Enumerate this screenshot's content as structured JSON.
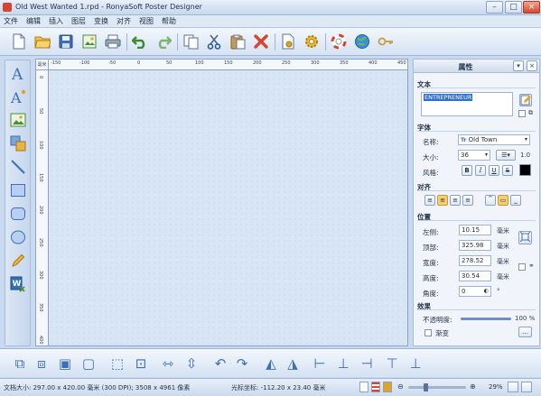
{
  "window": {
    "title": "Old West Wanted 1.rpd - RonyaSoft Poster Designer"
  },
  "menu": {
    "items": [
      "文件",
      "编辑",
      "插入",
      "图层",
      "变换",
      "对齐",
      "视图",
      "帮助"
    ]
  },
  "toolbar": {
    "buttons": [
      "new-icon",
      "open-icon",
      "save-icon",
      "export-icon",
      "print-icon",
      "undo-icon",
      "redo-icon",
      "copy-icon",
      "cut-icon",
      "paste-icon",
      "delete-icon",
      "page-settings-icon",
      "preferences-icon",
      "help-icon",
      "web-icon",
      "register-icon"
    ]
  },
  "left_tools": [
    "text-tool-icon",
    "curved-text-tool-icon",
    "image-tool-icon",
    "clipart-tool-icon",
    "line-tool-icon",
    "rectangle-tool-icon",
    "rounded-rectangle-tool-icon",
    "ellipse-tool-icon",
    "pencil-tool-icon",
    "word-art-tool-icon"
  ],
  "rulers": {
    "corner": "毫米",
    "top_ticks": [
      "-150",
      "-100",
      "-50",
      "0",
      "50",
      "100",
      "150",
      "200",
      "250",
      "300",
      "350",
      "400",
      "450"
    ],
    "left_ticks": [
      "0",
      "50",
      "100",
      "150",
      "200",
      "250",
      "300",
      "350",
      "400"
    ]
  },
  "panel": {
    "title": "属性",
    "text_section": {
      "label": "文本",
      "value": "ENTREPRENEUR"
    },
    "font_section": {
      "label": "字体",
      "name_label": "名称:",
      "name_value": "Old Town",
      "size_label": "大小:",
      "size_value": "36",
      "spacing_value": "1.0",
      "style_label": "风格:",
      "style_buttons": [
        "B",
        "I",
        "U",
        "S"
      ],
      "color": "#000000"
    },
    "align_section": {
      "label": "对齐"
    },
    "position_section": {
      "label": "位置",
      "rows": [
        {
          "label": "左侧:",
          "value": "10.15",
          "unit": "毫米"
        },
        {
          "label": "顶部:",
          "value": "325.98",
          "unit": "毫米"
        },
        {
          "label": "宽度:",
          "value": "278.52",
          "unit": "毫米"
        },
        {
          "label": "高度:",
          "value": "30.54",
          "unit": "毫米"
        },
        {
          "label": "角度:",
          "value": "0",
          "unit": "°"
        }
      ]
    },
    "effects_section": {
      "label": "效果",
      "opacity_label": "不透明度:",
      "opacity_value": "100 %",
      "opacity": 1.0,
      "gradient_label": "渐变"
    }
  },
  "bottom_tools": [
    "group-icon",
    "ungroup-icon",
    "bring-front-icon",
    "send-back-icon",
    "fit-page-icon",
    "fit-selection-icon",
    "fit-width-icon",
    "fit-height-icon",
    "rotate-left-icon",
    "rotate-right-icon",
    "flip-horizontal-icon",
    "flip-vertical-icon",
    "align-left-icon",
    "align-center-icon",
    "align-right-icon",
    "align-top-icon",
    "align-bottom-icon"
  ],
  "status": {
    "doc_size": "文档大小: 297.00 x 420.00 毫米 (300 DPI); 3508 x 4961 像素",
    "cursor": "光标坐标: -112.20 x 23.40 毫米",
    "zoom": "29%",
    "zoom_level": 0.29
  },
  "colors": {
    "accent": "#2f6fd0",
    "close_red": "#d6452f",
    "panel_bg": "#f1f5fb",
    "canvas_bg": "#d8e5f5"
  }
}
